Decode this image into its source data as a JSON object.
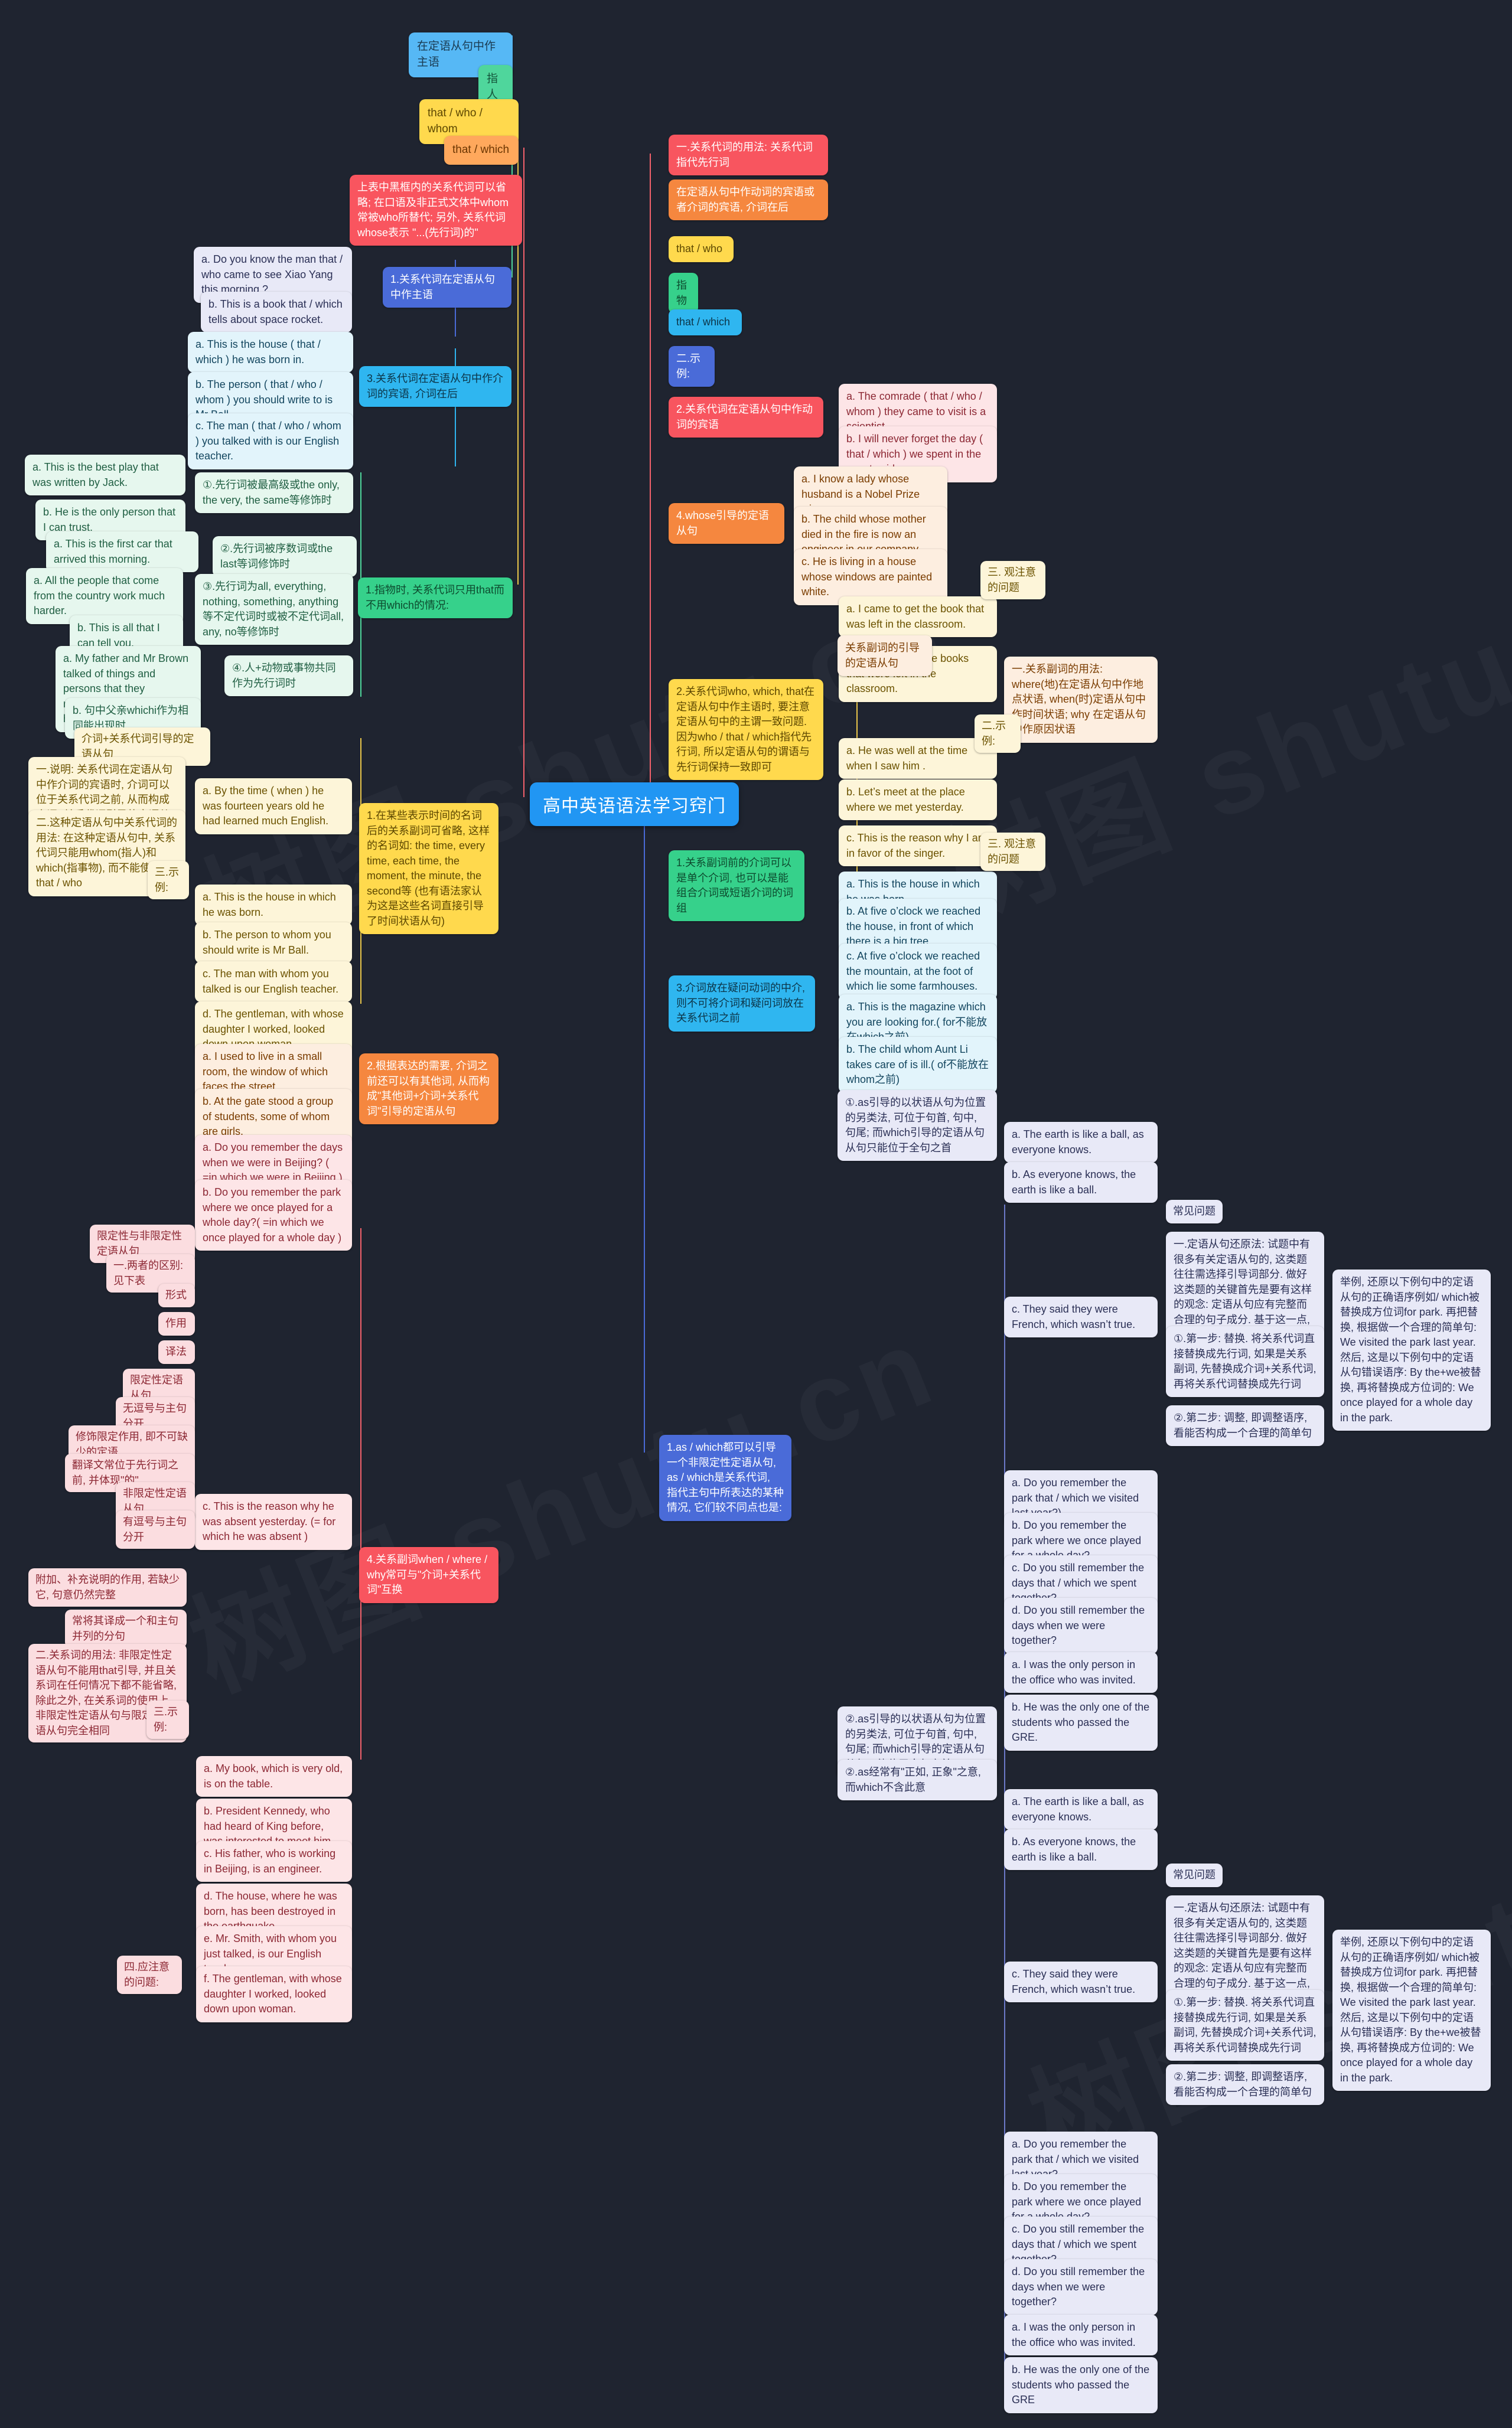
{
  "center": {
    "title": "高中英语语法学习窍门"
  },
  "watermarks": [
    "树图 shutu.cn",
    "树图 shutu.cn",
    "树图 shutu.cn"
  ],
  "branch_left_top": {
    "nodes": [
      {
        "id": "l1",
        "label": "在定语从句中作主语",
        "color": "c-blue"
      },
      {
        "id": "l2",
        "label": "指人",
        "color": "c-green"
      },
      {
        "id": "l3",
        "label": "that / who / whom",
        "color": "c-yellow"
      },
      {
        "id": "l4",
        "label": "that / which",
        "color": "c-orange"
      },
      {
        "id": "l5",
        "label": "上表中黑框内的关系代词可以省略; 在口语及非正式文体中whom常被who所替代; 另外, 关系代词whose表示 \"...(先行词)的\"",
        "color": "c-red"
      }
    ],
    "section1": {
      "label": "1.关系代词在定语从句中作主语",
      "color": "c-dblue",
      "examples": [
        "a. Do you know the man that / who came to see Xiao Yang this morning ?",
        "b. This is a book that / which tells about space rocket."
      ]
    },
    "section3": {
      "label": "3.关系代词在定语从句中作介词的宾语, 介词在后",
      "color": "c-cyan",
      "examples": [
        "a. This is the house ( that / which ) he was born in.",
        "b. The person ( that / who / whom ) you should write to is Mr Ball.",
        "c. The man ( that / who / whom ) you talked with is our English teacher."
      ]
    }
  },
  "branch_that_only": {
    "label": "1.指物时, 关系代词只用that而不用which的情况:",
    "color": "c-lgreen",
    "rules": [
      {
        "label": "①.先行词被最高级或the only, the very, the same等修饰时",
        "examples": [
          "a. This is the best play that was written by Jack.",
          "b. He is the only person that I can trust."
        ]
      },
      {
        "label": "②.先行词被序数词或the last等词修饰时",
        "examples": [
          "a. This is the first car that arrived this morning."
        ]
      },
      {
        "label": "③.先行词为all, everything, nothing, something, anything等不定代词时或被不定代词all, any, no等修饰时",
        "examples": [
          "a. All the people that come from the country work much harder.",
          "b. This is all that I can tell you."
        ]
      },
      {
        "label": "④.人+动物或事物共同作为先行词时",
        "examples": [
          "a. My father and Mr Brown talked of things and persons that they remembered for about an hour.",
          "b. 句中父亲whichi作为相同能出现时"
        ]
      }
    ]
  },
  "branch_prep": {
    "title": "介词+关系代词引导的定语从句",
    "color": "c-cream",
    "notes": [
      "一.说明: 关系代词在定语从句中作介词的宾语时, 介词可以位于关系代词之前, 从而构成介词+关系代词引导的定语从句",
      "二.这种定语从句中关系代词的用法: 在这种定语从句中, 关系代词只能用whom(指人)和which(指事物), 而不能使用that / who"
    ],
    "examples_label": "三.示例:",
    "examples": [
      "a. By the time ( when ) he was fourteen years old he had learned much English.",
      "a. This is the house in which he was born.",
      "b. The person to whom you should write is Mr Ball.",
      "c. The man with whom you talked is our English teacher.",
      "d. The gentleman, with whose daughter I worked, looked down upon woman."
    ],
    "rule1": {
      "label": "1.在某些表示时间的名词后的关系副词可省略, 这样的名词如: the time, every time, each time, the moment, the minute, the second等 (也有语法家认为这是这些名词直接引导了时间状语从句)",
      "color": "c-yellow"
    },
    "rule2": {
      "label": "2.根据表达的需要, 介词之前还可以有其他词, 从而构成\"其他词+介词+关系代词\"引导的定语从句",
      "color": "c-orange2",
      "examples": [
        "a. I used to live in a small room, the window of which faces the street.",
        "b. At the gate stood a group of students, some of whom are girls."
      ]
    },
    "rule4": {
      "label": "4.关系副词when / where / why常可与\"介词+关系代词\"互换",
      "color": "c-red2",
      "examples": [
        "a. Do you remember the days when we were in Beijing? ( =in which we were in Beijing )",
        "b. Do you remember the park where we once played for a whole day?( =in which we once played for a whole day )",
        "c. This is the reason why he was absent yesterday. (= for which he was absent )"
      ]
    },
    "label_examples_bottom": "三.示例:"
  },
  "branch_restrictive": {
    "items": [
      "限定性与非限定性定语从句",
      "一.两者的区别: 见下表",
      "形式",
      "作用",
      "译法",
      "限定性定语从句",
      "无逗号与主句分开",
      "修饰限定作用, 即不可缺少的定语",
      "翻译文常位于先行词之前, 并体现\"的\"",
      "非限定性定语从句",
      "有逗号与主句分开",
      "附加、补充说明的作用, 若缺少它, 句意仍然完整",
      "常将其译成一个和主句并列的分句",
      "二.关系词的用法: 非限定性定语从句不能用that引导, 并且关系词在任何情况下都不能省略, 除此之外, 在关系词的使用上, 非限定性定语从句与限定性定语从句完全相同",
      "三.示例:"
    ],
    "examples": [
      "a. My book, which is very old, is on the table.",
      "b. President Kennedy, who had heard of King before, was interested to meet him.",
      "c. His father, who is working in Beijing, is an engineer.",
      "d. The house, where he was born, has been destroyed in the earthquake.",
      "e. Mr. Smith, with whom you just talked, is our English teacher.",
      "f. The gentleman, with whose daughter I worked, looked down upon woman."
    ],
    "attention_label": "四.应注意的问题:"
  },
  "branch_right_top": {
    "nodes": [
      {
        "label": "一.关系代词的用法: 关系代词指代先行词",
        "color": "c-red2"
      },
      {
        "label": "在定语从句中作动词的宾语或者介词的宾语, 介词在后",
        "color": "c-orange2"
      },
      {
        "label": "that / who",
        "color": "c-yellow"
      },
      {
        "label": "指物",
        "color": "c-lgreen"
      },
      {
        "label": "that / which",
        "color": "c-cyan"
      },
      {
        "label": "二.示例:",
        "color": "c-dblue"
      }
    ]
  },
  "branch_right": {
    "section2": {
      "label": "2.关系代词在定语从句中作动词的宾语",
      "color": "c-red2",
      "examples": [
        "a. The comrade ( that / who / whom ) they came to visit is a scientist.",
        "b. I will never forget the day ( that / which ) we spent in the countryside."
      ]
    },
    "section4": {
      "label": "4.whose引导的定语从句",
      "color": "c-orange2",
      "examples": [
        "a. I know a lady whose husband is a Nobel Prize winner.",
        "b. The child whose mother died in the fire is now an engineer in our company.",
        "c. He is living in a house whose windows are painted white."
      ]
    },
    "section_who": {
      "label": "2.关系代词who, which, that在定语从句中作主语时, 要注意定语从句中的主谓一致问题. 因为who / that / which指代先行词, 所以定语从句的谓语与先行词保持一致即可",
      "color": "c-yellow",
      "examples_a": [
        "a. I came to get the book that was left in the classroom.",
        "b. I came to get the books that were left in the classroom."
      ],
      "examples_b": [
        "a. He was well at the time when I saw him .",
        "b. Let’s meet at the place where we met yesterday.",
        "c. This is the reason why I am in favor of the singer."
      ]
    },
    "section_adv": {
      "label": "1.关系副词前的介词可以是单个介词, 也可以是能组合介词或短语介词的词组",
      "color": "c-lgreen",
      "examples": [
        "a. This is the house in which he was born",
        "b. At five o’clock we reached the house, in front of which there is a big tree.",
        "c. At five o’clock we reached the mountain, at the foot of which lie some farmhouses."
      ]
    },
    "section_prep2": {
      "label": "3.介词放在疑问动词的中介, 则不可将介词和疑问词放在关系代词之前",
      "color": "c-cyan",
      "examples": [
        "a. This is the magazine which you are looking for.( for不能放在which之前)",
        "b. The child whom Aunt Li takes care of is ill.( of不能放在whom之前)"
      ]
    },
    "section_as": {
      "label": "1.as / which都可以引导一个非限定性定语从句, as / which是关系代词, 指代主句中所表达的某种情况, 它们较不同点也是:",
      "color": "c-dblue"
    }
  },
  "right_notes": [
    {
      "label": "①.as引导的以状语从句为位置的另类法, 可位于句首, 句中, 句尾; 而which引导的定语从句从句只能位于全句之首",
      "color": "c-lav"
    },
    {
      "label": "关系副词的引导的定语从句",
      "color": "c-peach"
    },
    {
      "label": "一.关系副词的用法: where(地)在定语从句中作地点状语, when(时)定语从句中作时间状语; why 在定语从句中作原因状语",
      "color": "c-peach"
    },
    {
      "label": "二.示例:",
      "color": "c-cream"
    },
    {
      "label": "三. 观注意的问题",
      "color": "c-cream"
    },
    {
      "label": "三. 观注意的问题",
      "color": "c-cream"
    },
    {
      "label": "②.as经常有\"正如, 正象\"之意, 而which不含此意",
      "color": "c-lav"
    },
    {
      "label": "②.as引导的以状语从句为位置的另类法, 可位于句首, 句中, 句尾; 而which引导的定语从句从句只能位于全句之首",
      "color": "c-lav"
    },
    {
      "label": "②.as经常有\"正如, 正象\"之意, 而which不含此意",
      "color": "c-lav"
    }
  ],
  "right_examples_group1": {
    "items": [
      "a. The earth is like a ball, as everyone knows.",
      "b. As everyone knows, the earth is like a ball.",
      "c. They said they were French, which wasn’t true."
    ]
  },
  "right_examples_group2": {
    "items": [
      "a. Do you remember the park that / which we visited last year?),",
      "b. Do you remember the park where we once played for a whole day?",
      "c. Do you still remember the days that / which we spent together?",
      "d. Do you still remember the days when we were together?",
      "a. I was the only person in the office who was invited.",
      "b. He was the only one of the students who passed the GRE."
    ]
  },
  "right_common": {
    "title": "常见问题",
    "color": "c-lav",
    "paragraph": "一.定语从句还原法: 试题中有很多有关定语从句的, 这类题往往需选择引导词部分. 做好这类题的关键首先是要有这样的观念: 定语从句应有完整而合理的句子成分. 基于这一点, 我们可以用\"还原法\"来检验定语从句是否正确, 即把定语从句还原成为一个简单句. 具体做法是:",
    "step1": "①.第一步: 替换. 将关系代词直接替换成先行词, 如果是关系副词, 先替换成介词+关系代词, 再将关系代词替换成先行词",
    "step2": "②.第二步: 调整, 即调整语序, 看能否构成一个合理的简单句",
    "right_long": "举例, 还原以下例句中的定语从句的正确语序例如/ which被替换成方位词for park. 再把替换, 根据做一个合理的简单句: We visited the park last year. 然后, 这是以下例句中的定语从句错误语序: By the+we被替换, 再将替换成方位词的: We once played for a whole day in the park."
  },
  "right_common2": {
    "title": "常见问题",
    "color": "c-lav",
    "paragraph": "一.定语从句还原法: 试题中有很多有关定语从句的, 这类题往往需选择引导词部分. 做好这类题的关键首先是要有这样的观念: 定语从句应有完整而合理的句子成分. 基于这一点, 我们可以用\"还原法\"来检验定语从句是否正确, 即把定语从句还原成为一个简单句. 具体做法是:",
    "step1": "①.第一步: 替换. 将关系代词直接替换成先行词, 如果是关系副词, 先替换成介词+关系代词, 再将关系代词替换成先行词",
    "step2": "②.第二步: 调整, 即调整语序, 看能否构成一个合理的简单句",
    "right_long": "举例, 还原以下例句中的定语从句的正确语序例如/ which被替换成方位词for park. 再把替换, 根据做一个合理的简单句: We visited the park last year. 然后, 这是以下例句中的定语从句错误语序: By the+we被替换, 再将替换成方位词的: We once played for a whole day in the park."
  },
  "right_examples_group3": {
    "items": [
      "a. The earth is like a ball, as everyone knows.",
      "b. As everyone knows, the earth is like a ball.",
      "c. They said they were French, which wasn’t true."
    ]
  },
  "right_examples_group4": {
    "items": [
      "a. Do you remember the park that / which we visited last year?",
      "b. Do you remember the park where we once played for a whole day?",
      "c. Do you still remember the days that / which we spent together?",
      "d. Do you still remember the days when we were together?",
      "a. I was the only person in the office who was invited.",
      "b. He was the only one of the students who passed the GRE"
    ]
  },
  "colors": {
    "background": "#1f2430",
    "accent": "#2196f3",
    "red": "#f8555f",
    "orange": "#f5873f",
    "yellow": "#ffd94d",
    "green": "#36d18b",
    "cyan": "#2fb6f0",
    "dblue": "#4a6bd8"
  }
}
